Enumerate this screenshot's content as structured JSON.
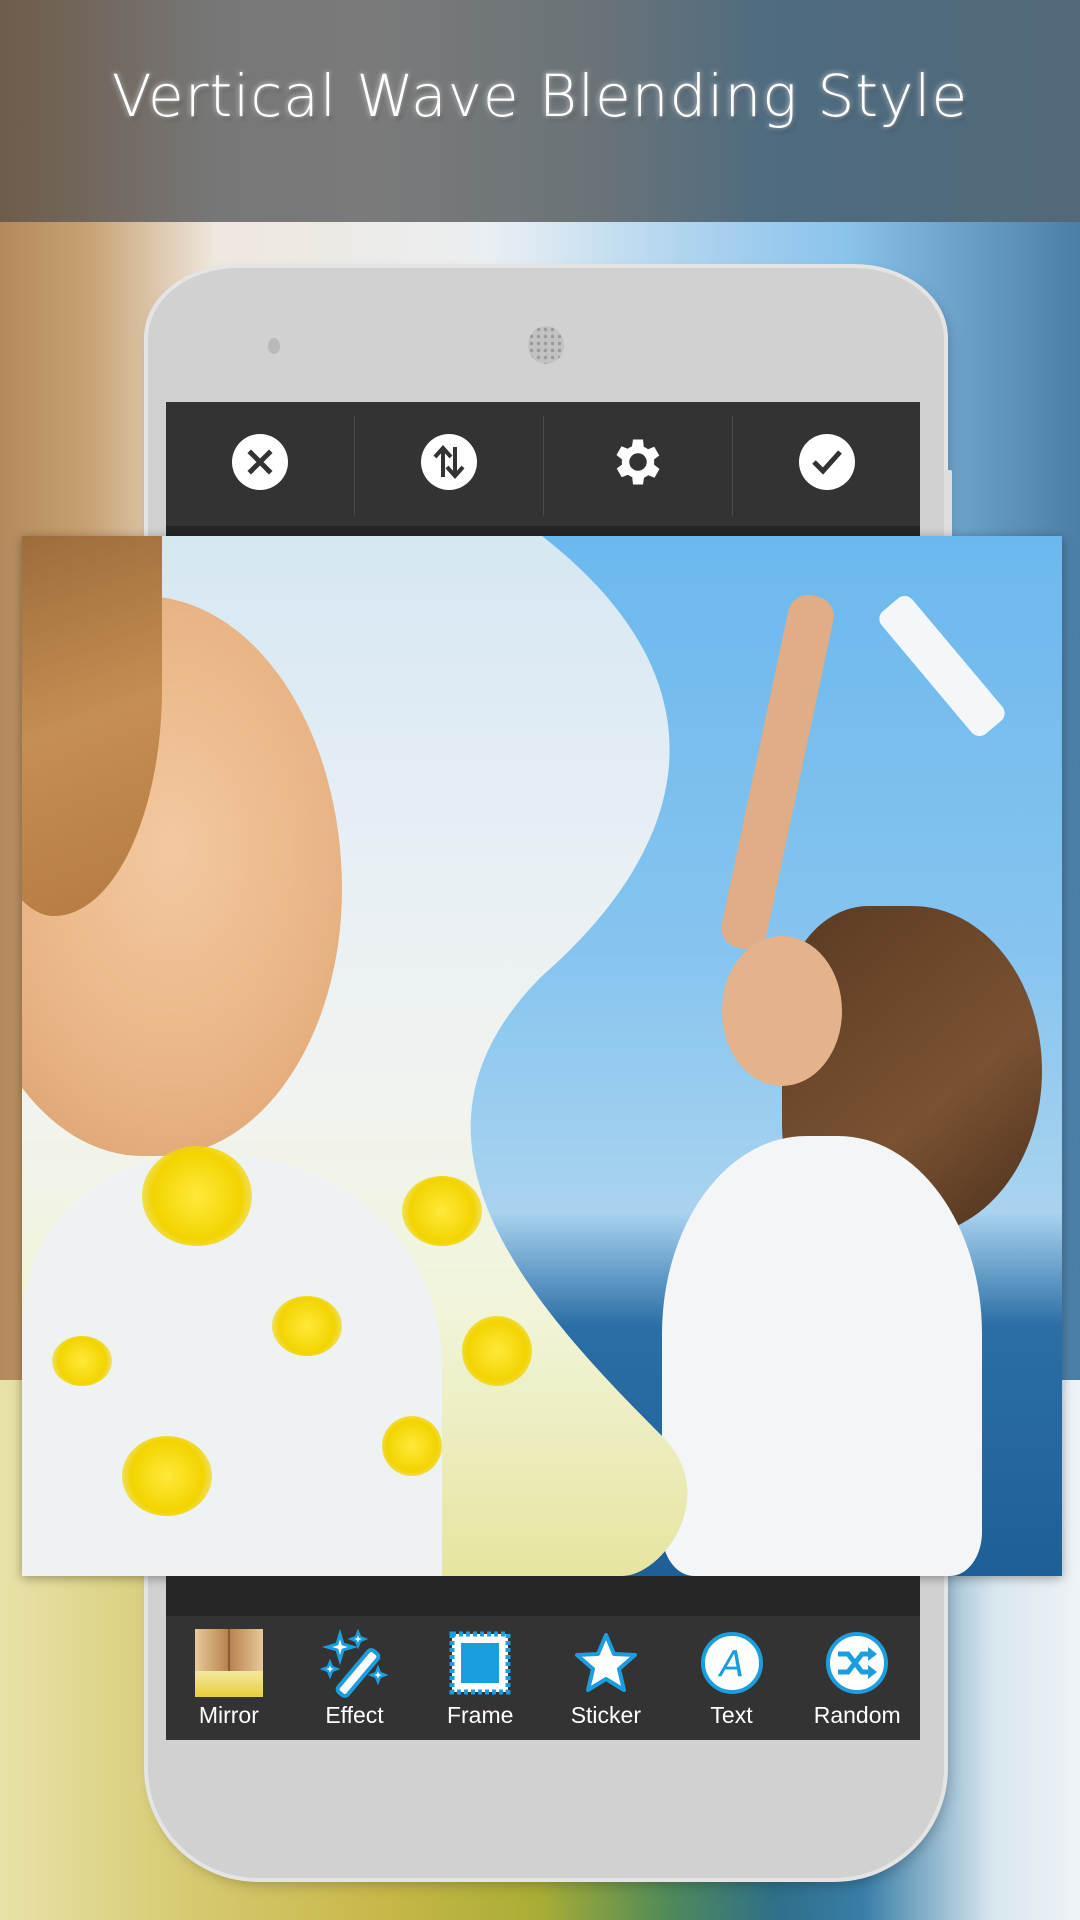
{
  "banner": {
    "title": "Vertical Wave Blending Style"
  },
  "top_toolbar": {
    "buttons": [
      {
        "name": "close",
        "icon": "close-icon"
      },
      {
        "name": "swap",
        "icon": "swap-vertical-icon"
      },
      {
        "name": "settings",
        "icon": "gear-icon"
      },
      {
        "name": "confirm",
        "icon": "checkmark-icon"
      }
    ]
  },
  "canvas": {
    "description": "Vertical wave blend of two photos"
  },
  "bottom_toolbar": {
    "tools": [
      {
        "label": "Mirror",
        "icon": "mirror-thumbnail"
      },
      {
        "label": "Effect",
        "icon": "magic-wand-icon"
      },
      {
        "label": "Frame",
        "icon": "frame-icon"
      },
      {
        "label": "Sticker",
        "icon": "star-icon"
      },
      {
        "label": "Text",
        "icon": "text-icon"
      },
      {
        "label": "Random",
        "icon": "shuffle-icon"
      }
    ]
  },
  "colors": {
    "accent": "#1a9ee0",
    "toolbar": "#333333"
  }
}
